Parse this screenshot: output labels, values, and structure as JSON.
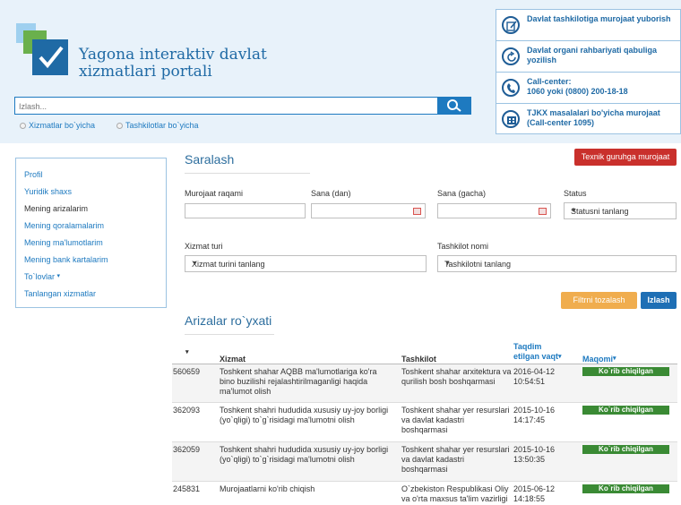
{
  "brand": {
    "title": "Yagona interaktiv davlat xizmatlari portali"
  },
  "search": {
    "placeholder": "Izlash...",
    "option_services": "Xizmatlar bo`yicha",
    "option_orgs": "Tashkilotlar bo`yicha"
  },
  "quick_links": [
    {
      "icon": "edit-icon",
      "text": "Davlat tashkilotiga murojaat yuborish"
    },
    {
      "icon": "refresh-icon",
      "text": "Davlat organi rahbariyati qabuliga yozilish"
    },
    {
      "icon": "phone-icon",
      "text": "Call-center:",
      "text2": "1060 yoki (0800) 200-18-18"
    },
    {
      "icon": "building-icon",
      "text": "TJKX masalalari bo'yicha murojaat (Call-center 1095)"
    }
  ],
  "sidebar": {
    "items": [
      {
        "label": "Profil"
      },
      {
        "label": "Yuridik shaxs"
      },
      {
        "label": "Mening arizalarim"
      },
      {
        "label": "Mening qoralamalarim"
      },
      {
        "label": "Mening ma'lumotlarim"
      },
      {
        "label": "Mening bank kartalarim"
      },
      {
        "label": "To`lovlar"
      },
      {
        "label": "Tanlangan xizmatlar"
      }
    ]
  },
  "filter": {
    "title": "Saralash",
    "tech_support_button": "Texnik guruhga murojaat",
    "labels": {
      "request_number": "Murojaat raqami",
      "date_from": "Sana (dan)",
      "date_to": "Sana (gacha)",
      "status": "Status",
      "service_type": "Xizmat turi",
      "org_name": "Tashkilot nomi"
    },
    "status_select": "Statusni tanlang",
    "service_select": "Xizmat turini tanlang",
    "org_select": "Tashkilotni tanlang",
    "clear_button": "Filtrni tozalash",
    "search_button": "Izlash"
  },
  "list": {
    "title": "Arizalar ro`yxati",
    "columns": {
      "service": "Xizmat",
      "organization": "Tashkilot",
      "date": "Taqdim etilgan vaqt",
      "status": "Maqomi"
    },
    "rows": [
      {
        "id": "560659",
        "service": "Toshkent shahar AQBB ma'lumotlariga ko'ra bino buzilishi rejalashtirilmaganligi haqida ma'lumot olish",
        "organization": "Toshkent shahar arxitektura va qurilish bosh boshqarmasi",
        "date": "2016-04-12",
        "time": "10:54:51",
        "status": "Ko`rib chiqilgan"
      },
      {
        "id": "362093",
        "service": "Toshkent shahri hududida xususiy uy-joy borligi (yo`qligi) to`g`risidagi ma'lumotni olish",
        "organization": "Toshkent shahar yer resurslari va davlat kadastri boshqarmasi",
        "date": "2015-10-16",
        "time": "14:17:45",
        "status": "Ko`rib chiqilgan"
      },
      {
        "id": "362059",
        "service": "Toshkent shahri hududida xususiy uy-joy borligi (yo`qligi) to`g`risidagi ma'lumotni olish",
        "organization": "Toshkent shahar yer resurslari va davlat kadastri boshqarmasi",
        "date": "2015-10-16",
        "time": "13:50:35",
        "status": "Ko`rib chiqilgan"
      },
      {
        "id": "245831",
        "service": "Murojaatlarni ko'rib chiqish",
        "organization": "O`zbekiston Respublikasi Oliy va o'rta maxsus ta'lim vazirligi",
        "date": "2015-06-12",
        "time": "14:18:55",
        "status": "Ko`rib chiqilgan"
      }
    ]
  },
  "colors": {
    "accent": "#1e7ac0",
    "success": "#3a8a34",
    "danger": "#c9302c",
    "warning": "#f0ad4e"
  }
}
